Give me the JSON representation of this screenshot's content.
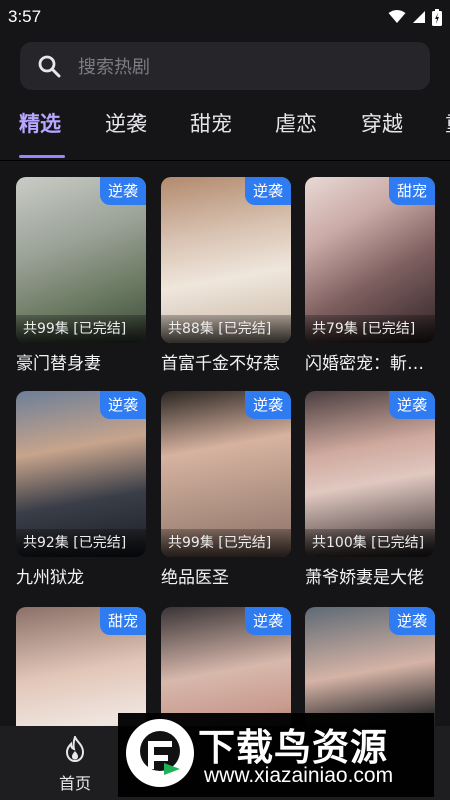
{
  "status": {
    "time": "3:57"
  },
  "search": {
    "placeholder": "搜索热剧"
  },
  "tabs": [
    {
      "label": "精选",
      "active": true
    },
    {
      "label": "逆袭",
      "active": false
    },
    {
      "label": "甜宠",
      "active": false
    },
    {
      "label": "虐恋",
      "active": false
    },
    {
      "label": "穿越",
      "active": false
    },
    {
      "label": "重",
      "active": false
    }
  ],
  "cards": [
    {
      "title": "豪门替身妻",
      "badge": "逆袭",
      "episodes": "共99集 [已完结]"
    },
    {
      "title": "首富千金不好惹",
      "badge": "逆袭",
      "episodes": "共88集 [已完结]"
    },
    {
      "title": "闪婚密宠：斬…",
      "badge": "甜宠",
      "episodes": "共79集 [已完结]"
    },
    {
      "title": "九州狱龙",
      "badge": "逆袭",
      "episodes": "共92集 [已完结]"
    },
    {
      "title": "绝品医圣",
      "badge": "逆袭",
      "episodes": "共99集 [已完结]"
    },
    {
      "title": "萧爷娇妻是大佬",
      "badge": "逆袭",
      "episodes": "共100集 [已完结]"
    },
    {
      "title": "",
      "badge": "甜宠",
      "episodes": ""
    },
    {
      "title": "",
      "badge": "逆袭",
      "episodes": ""
    },
    {
      "title": "",
      "badge": "逆袭",
      "episodes": ""
    }
  ],
  "nav": {
    "home_label": "首页"
  },
  "watermark": {
    "text": "下载鸟资源",
    "url": "www.xiazainiao.com"
  },
  "colors": {
    "accent": "#b9a6ff",
    "badge": "#2f7cf2",
    "background": "#151517"
  }
}
